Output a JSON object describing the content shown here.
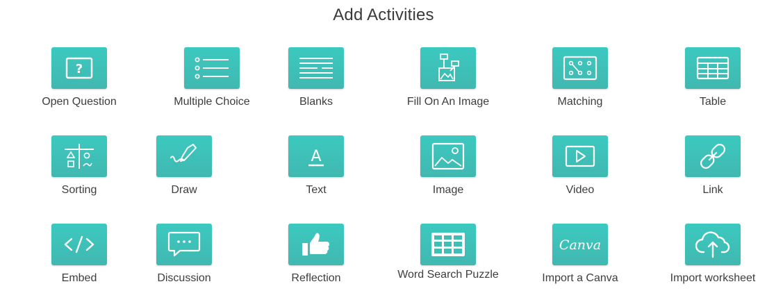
{
  "title": "Add Activities",
  "accent_color": "#40bdb5",
  "activities": [
    {
      "label": "Open Question",
      "icon": "question-box-icon"
    },
    {
      "label": "Multiple Choice",
      "icon": "list-icon"
    },
    {
      "label": "Blanks",
      "icon": "blanks-lines-icon"
    },
    {
      "label": "Fill On An Image",
      "icon": "image-labels-icon"
    },
    {
      "label": "Matching",
      "icon": "matching-icon"
    },
    {
      "label": "Table",
      "icon": "table-icon"
    },
    {
      "label": "Sorting",
      "icon": "sorting-icon"
    },
    {
      "label": "Draw",
      "icon": "pencil-draw-icon"
    },
    {
      "label": "Text",
      "icon": "text-a-icon"
    },
    {
      "label": "Image",
      "icon": "image-icon"
    },
    {
      "label": "Video",
      "icon": "video-play-icon"
    },
    {
      "label": "Link",
      "icon": "link-chain-icon"
    },
    {
      "label": "Embed",
      "icon": "code-embed-icon"
    },
    {
      "label": "Discussion",
      "icon": "chat-bubble-icon"
    },
    {
      "label": "Reflection",
      "icon": "thumbs-up-icon"
    },
    {
      "label": "Word Search Puzzle",
      "icon": "grid-puzzle-icon"
    },
    {
      "label": "Import a Canva",
      "icon": "canva-logo-icon"
    },
    {
      "label": "Import worksheet",
      "icon": "cloud-upload-icon"
    }
  ],
  "canva_logo_text": "Canva"
}
